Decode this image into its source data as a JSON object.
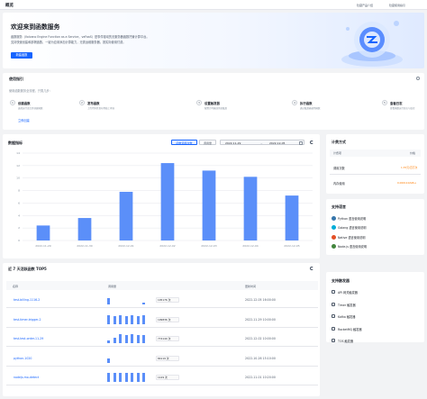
{
  "header": {
    "title": "概览",
    "links": [
      "隐藏产品介绍",
      "隐藏使用指引"
    ]
  },
  "intro": {
    "title": "欢迎来到函数服务",
    "desc1": "函数服务（Volcano Engine Function as a Service，veFaaS）是事件驱动的无服务器函数托管计算平台。",
    "desc2": "支持快速创建和部署函数，一键为应用添加计算能力，无需运维服务器，按实际使用付费。",
    "cta": "新建函数"
  },
  "guide": {
    "title": "使用指引",
    "subtitle": "使用函数服务全流程，只需几步：",
    "link": "立即创建",
    "steps": [
      {
        "num": "1",
        "title": "创建函数",
        "desc": "选择运行语言并创建函数"
      },
      {
        "num": "2",
        "title": "发布函数",
        "desc": "上传代码并发布到线上环境"
      },
      {
        "num": "3",
        "title": "设置触发器",
        "desc": "配置计时器或消息触发"
      },
      {
        "num": "4",
        "title": "执行函数",
        "desc": "通过触发器调用函数"
      },
      {
        "num": "5",
        "title": "查看日志",
        "desc": "查看函数运行日志与监控"
      }
    ]
  },
  "metrics": {
    "title": "数据指标",
    "tabs": [
      "函数调用次数",
      "调用量"
    ],
    "date_start": "2022-11-29",
    "date_sep": "~",
    "date_end": "2022-12-05"
  },
  "chart_data": {
    "type": "bar",
    "title": "",
    "categories": [
      "2022-11-29",
      "2022-11-30",
      "2022-12-01",
      "2022-12-02",
      "2022-12-03",
      "2022-12-04",
      "2022-12-05"
    ],
    "values": [
      2.4,
      3.6,
      7.8,
      12.4,
      11.2,
      10.2,
      7.2
    ],
    "ylim": [
      0,
      14
    ],
    "yticks": [
      "14",
      "12",
      "10",
      "8",
      "6",
      "4",
      "2",
      "0"
    ],
    "grid": true,
    "bar_color": "#5b8ff9"
  },
  "top": {
    "title": "近 7 天活跃函数 TOP5",
    "columns": [
      "名称",
      "调用量",
      "",
      "更新时间"
    ],
    "rows": [
      {
        "name": "test-billing-1116-2",
        "count": "105176 次",
        "time": "2022-12-05 16:00:00",
        "spark": [
          6,
          0,
          0,
          0,
          0,
          0,
          2
        ]
      },
      {
        "name": "test-timer-trigger-2",
        "count": "199836 次",
        "time": "2022-11-29 10:00:00",
        "spark": [
          9,
          8,
          9,
          8,
          9,
          8,
          9
        ]
      },
      {
        "name": "test-test-order-11-29",
        "count": "774140 次",
        "time": "2022-12-02 10:00:00",
        "spark": [
          3,
          5,
          9,
          8,
          9,
          8,
          8
        ]
      },
      {
        "name": "python-1020",
        "count": "84119 次",
        "time": "2022-10-26 15:10:00",
        "spark": [
          4,
          0,
          0,
          0,
          0,
          0,
          0
        ]
      },
      {
        "name": "nodejs-mo-detect",
        "count": "1129 次",
        "time": "2022-11-01 10:20:00",
        "spark": [
          9,
          9,
          9,
          9,
          9,
          9,
          9
        ]
      }
    ]
  },
  "billing": {
    "title": "计费方式",
    "col_item": "计费项",
    "col_price": "价格",
    "rows": [
      {
        "item": "调用次数",
        "price": "1.35元/百万次"
      },
      {
        "item": "内存使用",
        "price": "0.000110/GB-s"
      }
    ]
  },
  "languages": {
    "title": "支持语言",
    "items": [
      {
        "label": "Python 语言使用说明",
        "icon": "python-icon",
        "color": "#3776ab"
      },
      {
        "label": "Golang 语言使用说明",
        "icon": "golang-icon",
        "color": "#00add8"
      },
      {
        "label": "Native 语言使用说明",
        "icon": "native-icon",
        "color": "#e34f26"
      },
      {
        "label": "Node.js 语言使用说明",
        "icon": "nodejs-icon",
        "color": "#43853d"
      }
    ]
  },
  "triggers": {
    "title": "支持触发器",
    "items": [
      "API 网关触发器",
      "Timer 触发器",
      "Kafka 触发器",
      "RocketMQ 触发器",
      "TOS 触发器"
    ]
  }
}
